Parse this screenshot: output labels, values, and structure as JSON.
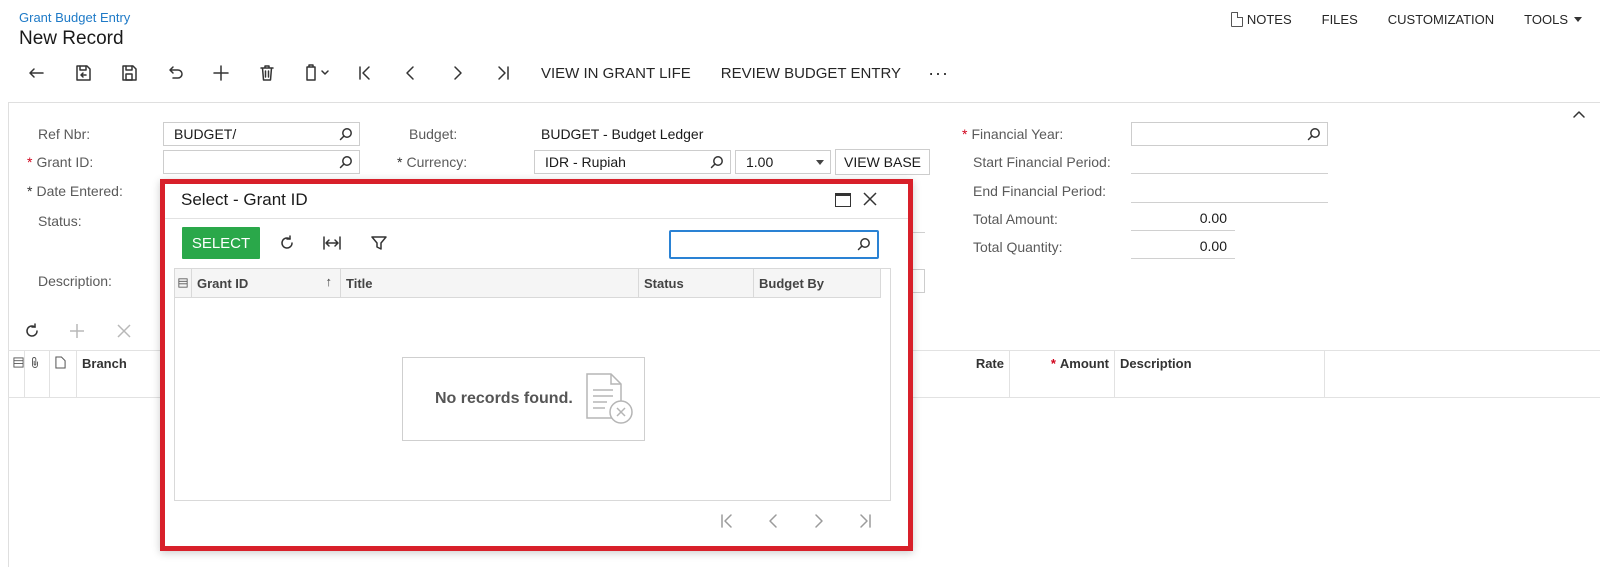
{
  "header": {
    "breadcrumb": "Grant Budget Entry",
    "title": "New Record",
    "links": {
      "notes": "NOTES",
      "files": "FILES",
      "customization": "CUSTOMIZATION",
      "tools": "TOOLS"
    }
  },
  "toolbar": {
    "view_in_grant_life": "VIEW IN GRANT LIFE",
    "review_budget_entry": "REVIEW BUDGET ENTRY",
    "more": "···"
  },
  "form": {
    "ref_nbr": {
      "label": "Ref Nbr:",
      "value": "BUDGET/"
    },
    "grant_id": {
      "label": "Grant ID:",
      "value": ""
    },
    "date_entered": {
      "label": "Date Entered:"
    },
    "status": {
      "label": "Status:"
    },
    "description": {
      "label": "Description:"
    },
    "budget": {
      "label": "Budget:",
      "value": "BUDGET - Budget Ledger"
    },
    "currency": {
      "label": "Currency:",
      "value": "IDR - Rupiah",
      "rate": "1.00",
      "view_base": "VIEW BASE"
    },
    "financial_year": {
      "label": "Financial Year:",
      "value": ""
    },
    "start_financial_period": {
      "label": "Start Financial Period:",
      "value": ""
    },
    "end_financial_period": {
      "label": "End Financial Period:",
      "value": ""
    },
    "total_amount": {
      "label": "Total Amount:",
      "value": "0.00"
    },
    "total_quantity": {
      "label": "Total Quantity:",
      "value": "0.00"
    }
  },
  "grid": {
    "columns": {
      "branch": "Branch",
      "rate": "Rate",
      "amount": "Amount",
      "description": "Description"
    }
  },
  "dialog": {
    "title": "Select - Grant ID",
    "select_label": "SELECT",
    "search_value": "",
    "columns": {
      "grant_id": "Grant ID",
      "title": "Title",
      "status": "Status",
      "budget_by": "Budget By"
    },
    "sort_indicator": "↑",
    "empty_message": "No records found."
  },
  "colors": {
    "accent": "#1e7ac7",
    "select_button": "#2aa84a",
    "dialog_highlight": "#d8202a",
    "required": "#d0021b"
  }
}
